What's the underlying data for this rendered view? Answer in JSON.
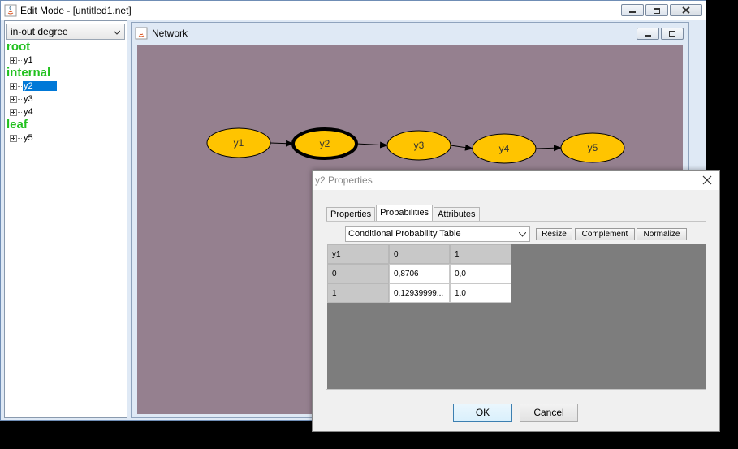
{
  "main_window": {
    "title": "Edit Mode - [untitled1.net]"
  },
  "sidebar": {
    "sort_combo": {
      "value": "in-out degree"
    },
    "groups": [
      {
        "label": "root",
        "nodes": [
          "y1"
        ]
      },
      {
        "label": "internal",
        "nodes": [
          "y2",
          "y3",
          "y4"
        ]
      },
      {
        "label": "leaf",
        "nodes": [
          "y5"
        ]
      }
    ],
    "selected_node": "y2"
  },
  "network": {
    "title": "Network",
    "canvas_color": "#95808f",
    "node_fill": "#ffc400",
    "nodes": [
      "y1",
      "y2",
      "y3",
      "y4",
      "y5"
    ],
    "edges": [
      [
        "y1",
        "y2"
      ],
      [
        "y2",
        "y3"
      ],
      [
        "y3",
        "y4"
      ],
      [
        "y4",
        "y5"
      ]
    ],
    "selected": "y2"
  },
  "dialog": {
    "title": "y2 Properties",
    "tabs": [
      "Properties",
      "Probabilities",
      "Attributes"
    ],
    "active_tab": "Probabilities",
    "table_type": "Conditional Probability Table",
    "buttons": {
      "resize": "Resize",
      "complement": "Complement",
      "normalize": "Normalize",
      "ok": "OK",
      "cancel": "Cancel"
    },
    "cpt": {
      "parent": "y1",
      "states": [
        "0",
        "1"
      ],
      "rows": [
        {
          "parent_state": "0",
          "values": [
            "0,8706",
            "0,0"
          ]
        },
        {
          "parent_state": "1",
          "values": [
            "0,12939999...",
            "1,0"
          ]
        }
      ]
    }
  }
}
